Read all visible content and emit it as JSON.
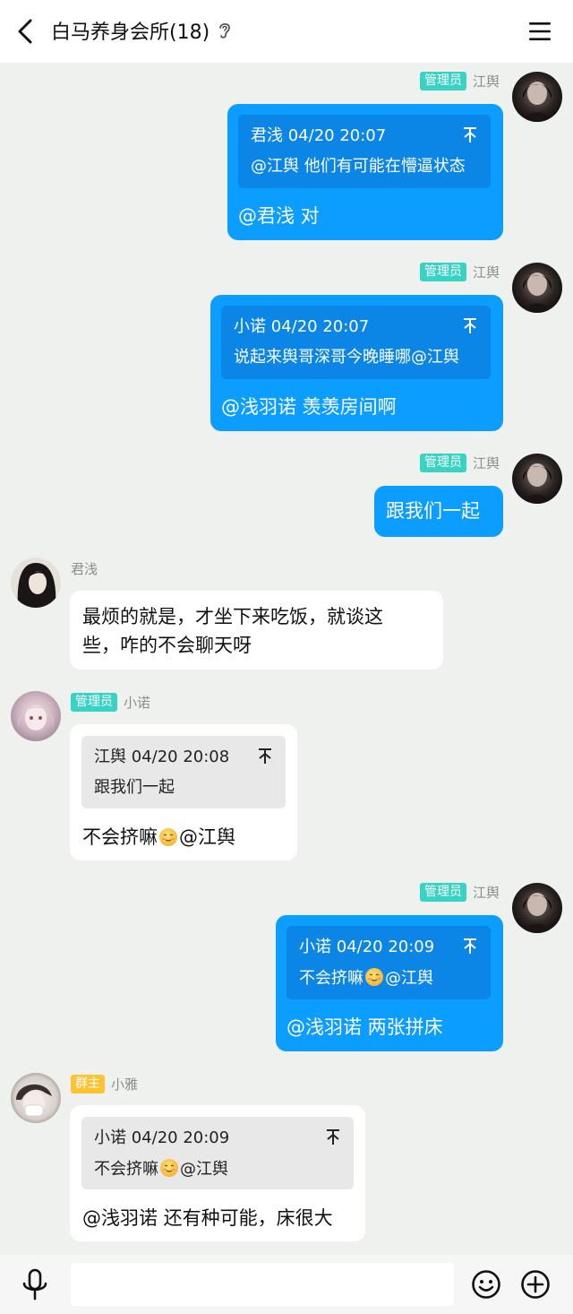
{
  "header": {
    "title": "白马养身会所(18)",
    "back_icon": "chevron-left-icon",
    "ear_icon": "ear-icon",
    "menu_icon": "hamburger-menu-icon"
  },
  "colors": {
    "my_bubble": "#0b9dff",
    "my_quote": "#0b86e6",
    "their_bubble": "#ffffff",
    "their_quote": "#e8e8e8",
    "admin_badge": "#38d3c4",
    "owner_badge": "#ffc331",
    "background": "#eef1ee"
  },
  "messages": [
    {
      "side": "right",
      "role": "管理员",
      "sender": "江舆",
      "quote": {
        "head": "君浅 04/20 20:07",
        "text": "@江舆 他们有可能在懵逼状态"
      },
      "text": "@君浅 对"
    },
    {
      "side": "right",
      "role": "管理员",
      "sender": "江舆",
      "quote": {
        "head": "小诺 04/20 20:07",
        "text": "说起来舆哥深哥今晚睡哪@江舆"
      },
      "text": "@浅羽诺 羡羡房间啊"
    },
    {
      "side": "right",
      "role": "管理员",
      "sender": "江舆",
      "text": "跟我们一起"
    },
    {
      "side": "left",
      "sender": "君浅",
      "lines": [
        "最烦的就是，才坐下来吃饭，就谈这",
        "些，咋的不会聊天呀"
      ]
    },
    {
      "side": "left",
      "role": "管理员",
      "sender": "小诺",
      "quote": {
        "head": "江舆 04/20 20:08",
        "text": "跟我们一起"
      },
      "text_before": "不会挤嘛",
      "text_after": "@江舆"
    },
    {
      "side": "right",
      "role": "管理员",
      "sender": "江舆",
      "quote": {
        "head": "小诺 04/20 20:09",
        "text_before": "不会挤嘛",
        "text_after": "@江舆"
      },
      "text": "@浅羽诺 两张拼床"
    },
    {
      "side": "left",
      "role": "群主",
      "sender": "小雅",
      "quote": {
        "head": "小诺 04/20 20:09",
        "text_before": "不会挤嘛",
        "text_after": "@江舆"
      },
      "text": "@浅羽诺 还有种可能，床很大"
    }
  ],
  "footer": {
    "input_value": "",
    "mic_icon": "microphone-icon",
    "emoji_icon": "smiley-icon",
    "plus_icon": "plus-circle-icon"
  }
}
